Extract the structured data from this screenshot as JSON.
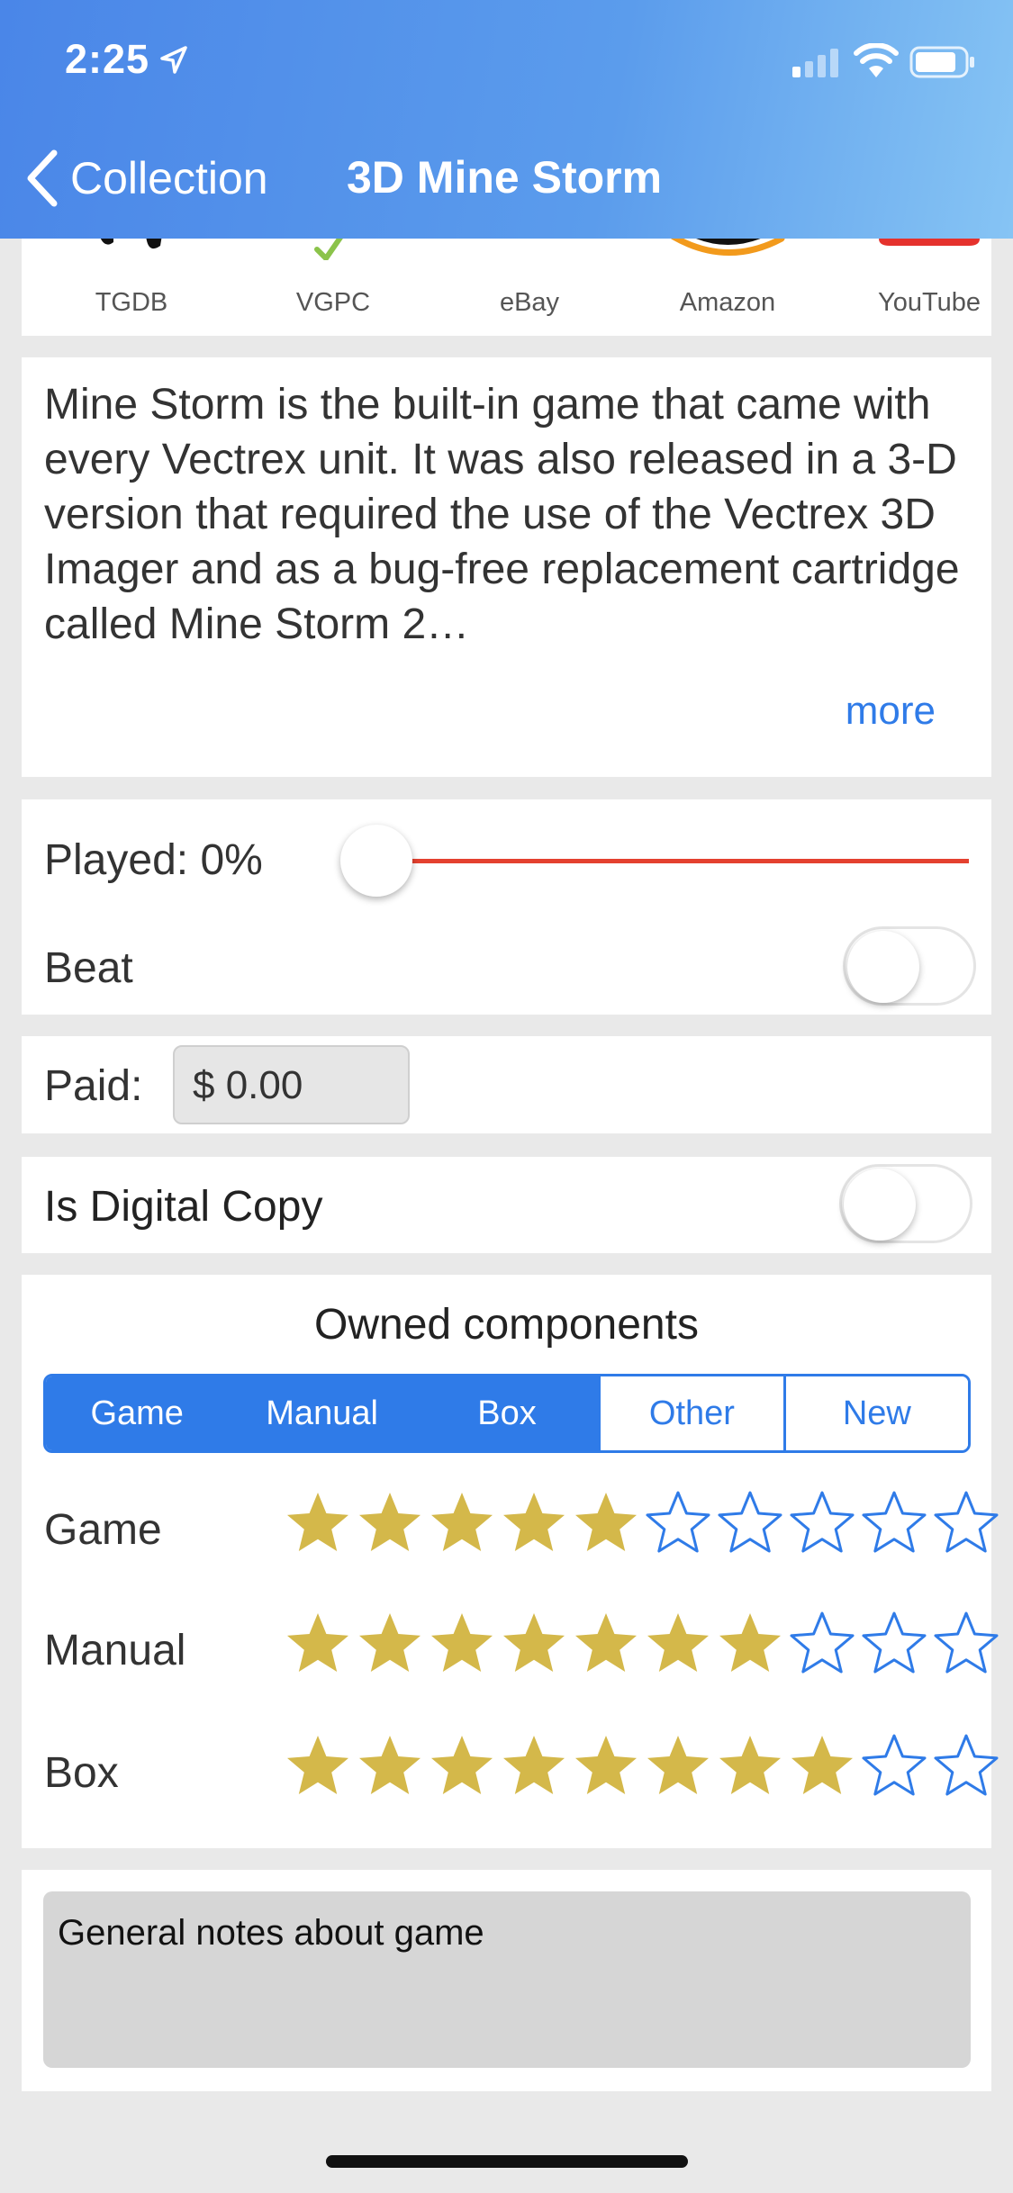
{
  "status_bar": {
    "time": "2:25"
  },
  "nav": {
    "back_label": "Collection",
    "title": "3D Mine Storm"
  },
  "links": [
    {
      "label": "TGDB",
      "icon": "tgdb-icon"
    },
    {
      "label": "VGPC",
      "icon": "vgpc-icon"
    },
    {
      "label": "eBay",
      "icon": "ebay-icon"
    },
    {
      "label": "Amazon",
      "icon": "amazon-icon"
    },
    {
      "label": "YouTube",
      "icon": "youtube-icon"
    }
  ],
  "description": {
    "text": "Mine Storm is the built-in game that came with every Vectrex unit. It was also released in a 3-D version that required the use of the Vectrex 3D Imager and as a bug-free replacement cartridge called Mine Storm 2…",
    "more_label": "more"
  },
  "progress": {
    "played_label": "Played: 0%",
    "played_value": 0,
    "beat_label": "Beat",
    "beat_on": false
  },
  "paid": {
    "label": "Paid:",
    "value": "$ 0.00"
  },
  "digital": {
    "label": "Is Digital Copy",
    "on": false
  },
  "owned": {
    "title": "Owned components",
    "segments": [
      {
        "label": "Game",
        "selected": true
      },
      {
        "label": "Manual",
        "selected": true
      },
      {
        "label": "Box",
        "selected": true
      },
      {
        "label": "Other",
        "selected": false
      },
      {
        "label": "New",
        "selected": false
      }
    ],
    "ratings": [
      {
        "label": "Game",
        "value": 5,
        "max": 10
      },
      {
        "label": "Manual",
        "value": 7,
        "max": 10
      },
      {
        "label": "Box",
        "value": 8,
        "max": 10
      }
    ]
  },
  "notes": {
    "placeholder": "General notes about game"
  },
  "colors": {
    "accent": "#2f7be8",
    "star_filled": "#d4b84a",
    "slider": "#e4412f"
  }
}
